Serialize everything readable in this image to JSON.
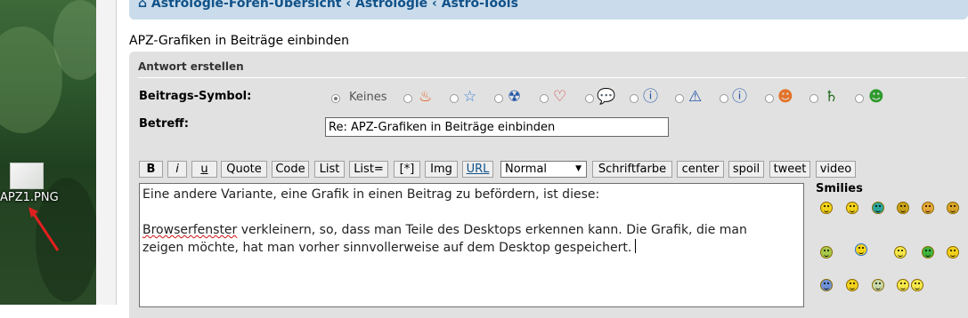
{
  "desktop": {
    "file_label": "APZ1.PNG"
  },
  "breadcrumb": {
    "home": "Astrologie-Foren-Übersicht",
    "sep1": "‹",
    "item2": "Astrologie",
    "sep2": "‹",
    "item3": "Astro-Tools"
  },
  "topic_title": "APZ-Grafiken in Beiträge einbinden",
  "reply_form": {
    "heading": "Antwort erstellen",
    "post_icon_label": "Beitrags-Symbol:",
    "none_option": "Keines",
    "subject_label": "Betreff:",
    "subject_value": "Re: APZ-Grafiken in Beiträge einbinden"
  },
  "toolbar": {
    "bold": "B",
    "italic": "i",
    "underline": "u",
    "quote": "Quote",
    "code": "Code",
    "list": "List",
    "list_eq": "List=",
    "list_item": "[*]",
    "img": "Img",
    "url": "URL",
    "font_size": "Normal",
    "font_color": "Schriftfarbe",
    "center": "center",
    "spoil": "spoil",
    "tweet": "tweet",
    "video": "video"
  },
  "message": {
    "line1": "Eine andere Variante, eine Grafik in einen Beitrag zu befördern, ist diese:",
    "line2_word": "Browserfenster",
    "line2_rest": " verkleinern, so, dass man Teile des Desktops erkennen kann. Die Grafik, die man",
    "line3": "zeigen möchte, hat man vorher sinnvollerweise auf dem Desktop gespeichert."
  },
  "smilies": {
    "title": "Smilies"
  },
  "colors": {
    "nav_bg": "#cadceb",
    "link": "#105289",
    "panel_bg": "#e1e1e1"
  }
}
